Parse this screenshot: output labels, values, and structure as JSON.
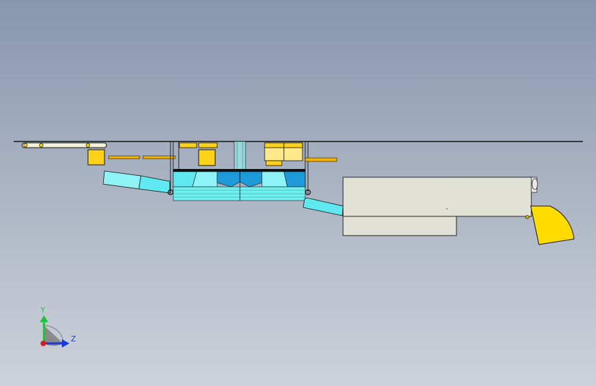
{
  "viewport": {
    "view": "side-elevation",
    "background": [
      "#8796ae",
      "#cdd2da"
    ]
  },
  "triad": {
    "y_label": "Y",
    "z_label": "Z",
    "y_color": "#1fbf3a",
    "z_color": "#1a3ad6",
    "x_color": "#d11f1f"
  },
  "colors": {
    "outline": "#1a1a1a",
    "cyan_light": "#8ff3f5",
    "cyan": "#4fe4ee",
    "blue": "#1e9ad8",
    "yellow": "#ffd21a",
    "yellow_pale": "#ffe98a",
    "machine_gray": "#e2e1d6",
    "conveyor_yellow": "#ffdc00"
  }
}
